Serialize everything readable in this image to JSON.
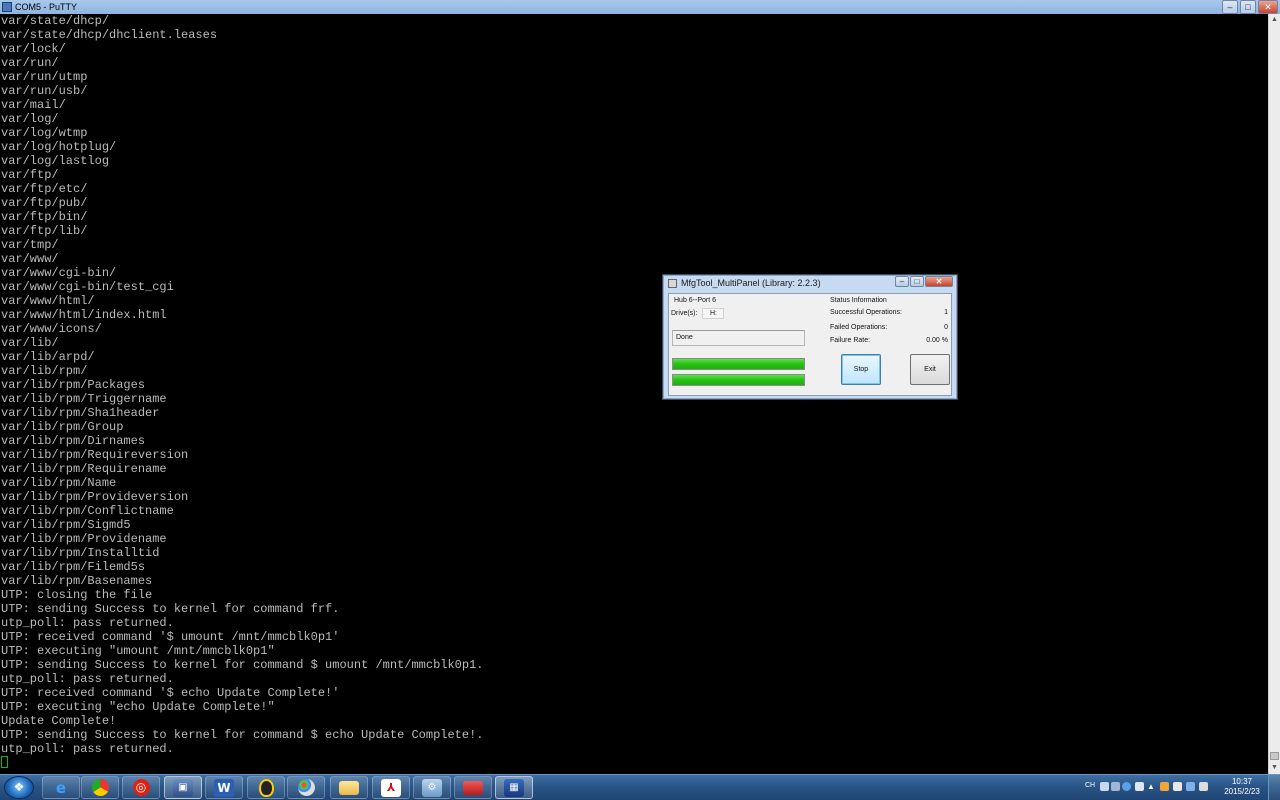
{
  "putty": {
    "title": "COM5 - PuTTY",
    "controls": {
      "minimize": "–",
      "maximize": "□",
      "close": "✕"
    }
  },
  "terminal": {
    "lines": [
      "var/state/dhcp/",
      "var/state/dhcp/dhclient.leases",
      "var/lock/",
      "var/run/",
      "var/run/utmp",
      "var/run/usb/",
      "var/mail/",
      "var/log/",
      "var/log/wtmp",
      "var/log/hotplug/",
      "var/log/lastlog",
      "var/ftp/",
      "var/ftp/etc/",
      "var/ftp/pub/",
      "var/ftp/bin/",
      "var/ftp/lib/",
      "var/tmp/",
      "var/www/",
      "var/www/cgi-bin/",
      "var/www/cgi-bin/test_cgi",
      "var/www/html/",
      "var/www/html/index.html",
      "var/www/icons/",
      "var/lib/",
      "var/lib/arpd/",
      "var/lib/rpm/",
      "var/lib/rpm/Packages",
      "var/lib/rpm/Triggername",
      "var/lib/rpm/Sha1header",
      "var/lib/rpm/Group",
      "var/lib/rpm/Dirnames",
      "var/lib/rpm/Requireversion",
      "var/lib/rpm/Requirename",
      "var/lib/rpm/Name",
      "var/lib/rpm/Provideversion",
      "var/lib/rpm/Conflictname",
      "var/lib/rpm/Sigmd5",
      "var/lib/rpm/Providename",
      "var/lib/rpm/Installtid",
      "var/lib/rpm/Filemd5s",
      "var/lib/rpm/Basenames",
      "UTP: closing the file",
      "UTP: sending Success to kernel for command frf.",
      "utp_poll: pass returned.",
      "UTP: received command '$ umount /mnt/mmcblk0p1'",
      "UTP: executing \"umount /mnt/mmcblk0p1\"",
      "UTP: sending Success to kernel for command $ umount /mnt/mmcblk0p1.",
      "utp_poll: pass returned.",
      "UTP: received command '$ echo Update Complete!'",
      "UTP: executing \"echo Update Complete!\"",
      "Update Complete!",
      "UTP: sending Success to kernel for command $ echo Update Complete!.",
      "utp_poll: pass returned."
    ]
  },
  "dialog": {
    "title": "MfgTool_MultiPanel (Library: 2.2.3)",
    "controls": {
      "minimize": "–",
      "maximize": "□",
      "close": "✕"
    },
    "hub_label": "Hub 6--Port 6",
    "drives_label": "Drive(s):",
    "drive_value": "H:",
    "status_text": "Done",
    "progress": [
      1.0,
      1.0
    ],
    "status_info": {
      "heading": "Status Information",
      "successful_label": "Successful Operations:",
      "successful_value": "1",
      "failed_label": "Failed Operations:",
      "failed_value": "0",
      "failure_rate_label": "Failure Rate:",
      "failure_rate_value": "0.00 %"
    },
    "stop_label": "Stop",
    "exit_label": "Exit"
  },
  "taskbar": {
    "lang": "CH",
    "clock_time": "10:37",
    "clock_date": "2015/2/23",
    "icons": [
      "ie-icon",
      "chrome-icon",
      "netease-music-icon",
      "putty-icon",
      "word-icon",
      "qq-icon",
      "paint-icon",
      "explorer-folder-icon",
      "pdf-reader-icon",
      "network-tool-icon",
      "toolbox-icon",
      "mfgtool-icon"
    ]
  },
  "colors": {
    "terminal_bg": "#000000",
    "terminal_fg": "#bbbbbb",
    "cursor": "#00c000",
    "progress_fill": "#27c214",
    "taskbar": "#2a5587"
  }
}
